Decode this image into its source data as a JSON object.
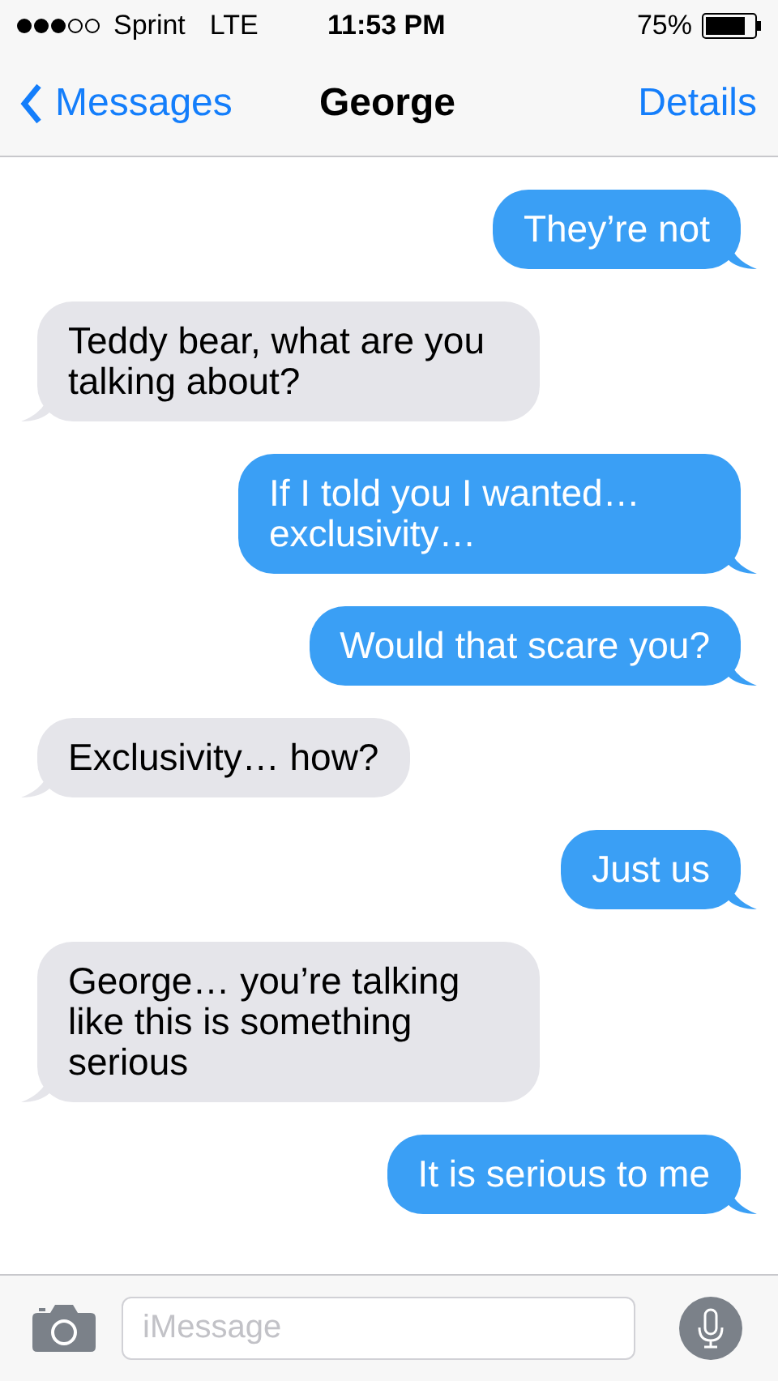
{
  "status_bar": {
    "carrier": "Sprint",
    "network": "LTE",
    "time": "11:53 PM",
    "battery": "75%"
  },
  "nav": {
    "back": "Messages",
    "title": "George",
    "action": "Details"
  },
  "messages": [
    {
      "kind": "sent",
      "text": "They’re not"
    },
    {
      "kind": "received",
      "text": "Teddy bear, what are you talking about?"
    },
    {
      "kind": "sent",
      "text": "If I told you I wanted… exclusivity…"
    },
    {
      "kind": "sent",
      "text": "Would that scare you?"
    },
    {
      "kind": "received",
      "text": "Exclusivity… how?"
    },
    {
      "kind": "sent",
      "text": "Just us"
    },
    {
      "kind": "received",
      "text": "George… you’re talking like this is something serious"
    },
    {
      "kind": "sent",
      "text": "It is serious to me"
    }
  ],
  "composer": {
    "placeholder": "iMessage"
  }
}
